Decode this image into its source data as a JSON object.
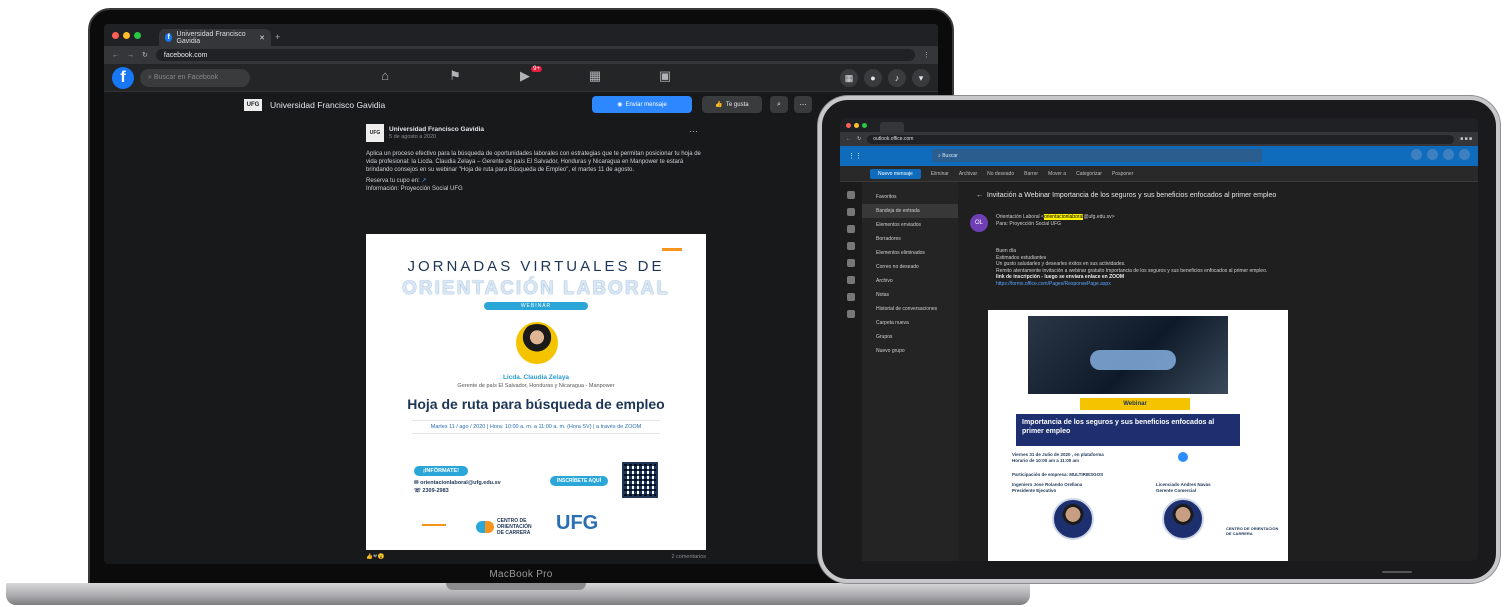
{
  "macbook": {
    "label": "MacBook Pro",
    "browser": {
      "tab_title": "Universidad Francisco Gavidia",
      "url": "facebook.com"
    },
    "facebook": {
      "search_placeholder": "Buscar en Facebook",
      "notification_count": "9+",
      "page_name": "Universidad Francisco Gavidia",
      "page_avatar": "UFG",
      "send_message_label": "Enviar mensaje",
      "like_label": "Te gusta",
      "post": {
        "author": "Universidad Francisco Gavidia",
        "date": "5 de agosto a 2020",
        "text": "Aplica un proceso efectivo para la búsqueda de oportunidades laborales con estrategias que te permitan posicionar tu hoja de vida profesional: la Licda. Claudia Zelaya – Gerente de país El Salvador, Honduras y Nicaragua en Manpower te estará brindando consejos en su webinar \"Hoja de ruta para Búsqueda de Empleo\", el martes 11 de agosto.",
        "line2": "Reserva tu cupo en:",
        "line3": "Información: Proyección Social UFG"
      },
      "poster": {
        "line1": "JORNADAS VIRTUALES DE",
        "line2": "ORIENTACIÓN LABORAL",
        "webinar": "WEBINAR",
        "speaker": "Licda. Claudia Zelaya",
        "role": "Gerente de país El Salvador, Honduras y Nicaragua - Manpower",
        "headline": "Hoja de ruta para búsqueda de empleo",
        "schedule": "Martes 11 / ago / 2020 | Hora: 10:00 a. m. a 11:00 a. m. (Hora SV) | a través de ZOOM",
        "info_badge": "¡INFÓRMATE!",
        "email": "orientacionlaboral@ufg.edu.sv",
        "phone": "2309-2983",
        "signup": "INSCRÍBETE AQUÍ",
        "center_logo": "CENTRO DE ORIENTACIÓN DE CARRERA",
        "ufg_logo": "UFG"
      },
      "comments": "2 comentarios"
    }
  },
  "ipad": {
    "browser": {
      "url": "outlook.office.com"
    },
    "outlook": {
      "search_placeholder": "Buscar",
      "new_message": "Nuevo mensaje",
      "ribbon": [
        "Eliminar",
        "Archivar",
        "No deseado",
        "Barrer",
        "Mover a",
        "Categorizar",
        "Posponer"
      ],
      "folders": [
        "Favoritos",
        "Bandeja de entrada",
        "Elementos enviados",
        "Borradores",
        "Elementos eliminados",
        "Correo no deseado",
        "Archivo",
        "Notas",
        "Historial de conversaciones",
        "Carpeta nueva",
        "Grupos",
        "Nuevo grupo"
      ],
      "subject": "Invitación a Webinar Importancia de los seguros y sus beneficios enfocados al primer empleo",
      "sender_initials": "OL",
      "sender": "Orientación Laboral",
      "sender_highlight": "orientacionlaboral",
      "sender_domain": "@ufg.edu.sv",
      "to_line": "Para: Proyección Social UFG",
      "body": [
        "Buen día",
        "Estimados estudiantes",
        "Un gusto saludarles y desearles éxitos en sus actividades.",
        "Remito atentamente invitación a webinar gratuito Importancia de los seguros y sus beneficios enfocados al primer empleo."
      ],
      "body_bold": "link de inscripción - luego se enviara enlace en ZOOM",
      "body_link": "https://forms.office.com/Pages/ResponsePage.aspx",
      "flyer": {
        "tag": "Webinar",
        "title": "Importancia de los seguros y sus beneficios enfocados al primer empleo",
        "date": "Viernes 31 de Julio de 2020 , en plataforma",
        "time": "Horario de 10:00 am a 11:00 am",
        "partner": "Participación de empresa: MULTIRIESGOS",
        "speaker1": "Ingeniero Jose Rolando Orellana",
        "speaker1_role": "Presidente Ejecutivo",
        "speaker2": "Licenciado Andres Navas",
        "speaker2_role": "Gerente Comercial",
        "center_logo": "CENTRO DE ORIENTACIÓN DE CARRERA"
      }
    }
  }
}
